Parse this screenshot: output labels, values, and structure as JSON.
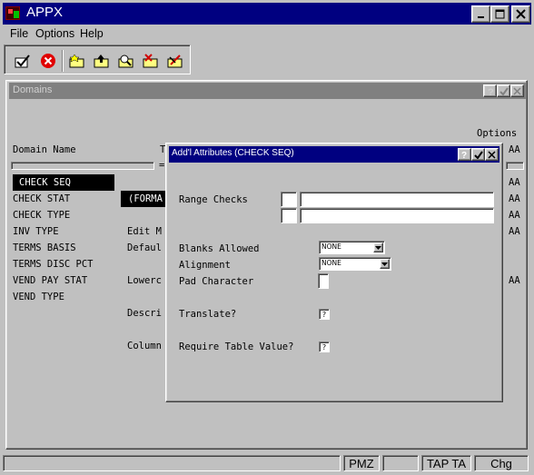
{
  "app": {
    "title": "APPX"
  },
  "menu": [
    "File",
    "Options",
    "Help"
  ],
  "toolbar": {
    "icons": [
      "check-icon",
      "cancel-icon",
      "folder-star-icon",
      "folder-up-icon",
      "folder-search-icon",
      "folder-x-icon",
      "folder-edit-icon"
    ]
  },
  "domains_window": {
    "title": "Domains",
    "options_header": "Options",
    "domain_name_header": "Domain Name",
    "col_t": "T",
    "equals": "=",
    "rows": [
      "CHECK SEQ",
      "CHECK STAT",
      "CHECK TYPE",
      "INV TYPE",
      "TERMS BASIS",
      "TERMS DISC PCT",
      "VEND PAY STAT",
      "VEND TYPE"
    ],
    "format_label": "(FORMA",
    "edit_label": "Edit M",
    "default_label": "Defaul",
    "lowercase_label": "Lowerc",
    "description_label": "Descri",
    "column_label": "Column",
    "options_values": [
      "AA",
      "AA",
      "AA",
      "AA",
      "AA",
      "AA"
    ]
  },
  "dialog": {
    "title": "Add'l Attributes (CHECK SEQ)",
    "range_checks_label": "Range Checks",
    "blanks_allowed_label": "Blanks Allowed",
    "blanks_allowed_value": "NONE",
    "alignment_label": "Alignment",
    "alignment_value": "NONE",
    "pad_character_label": "Pad Character",
    "translate_label": "Translate?",
    "translate_value": "?",
    "require_table_label": "Require Table Value?",
    "require_table_value": "?"
  },
  "status": {
    "pmz": "PMZ",
    "tap": "TAP TA",
    "mode": "Chg"
  }
}
